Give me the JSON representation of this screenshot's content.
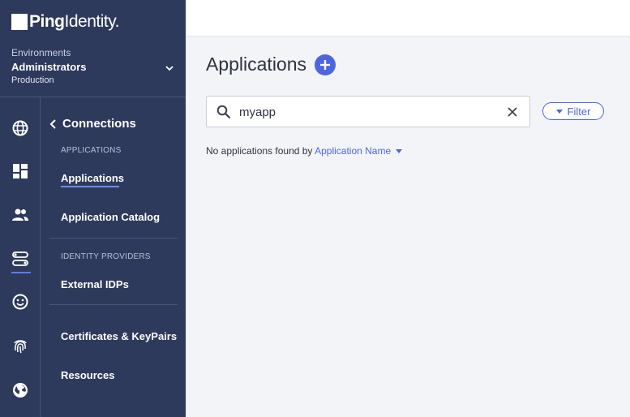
{
  "brand": {
    "bold": "Ping",
    "light": "Identity."
  },
  "environment": {
    "label": "Environments",
    "name": "Administrators",
    "type": "Production"
  },
  "rail": {
    "icons": [
      "globe-icon",
      "dashboard-icon",
      "users-icon",
      "connections-icon",
      "experiences-icon",
      "fingerprint-icon",
      "world-icon"
    ],
    "active": "connections-icon"
  },
  "subnav": {
    "back_title": "Connections",
    "section_applications": "APPLICATIONS",
    "item_applications": "Applications",
    "item_catalog": "Application Catalog",
    "section_idp": "IDENTITY PROVIDERS",
    "item_external_idps": "External IDPs",
    "item_certificates": "Certificates & KeyPairs",
    "item_resources": "Resources"
  },
  "main": {
    "title": "Applications",
    "search_value": "myapp",
    "filter_label": "Filter",
    "empty_prefix": "No applications found by",
    "empty_link": "Application Name"
  },
  "colors": {
    "sidebar": "#2e3a5c",
    "accent": "#4d65e3"
  }
}
